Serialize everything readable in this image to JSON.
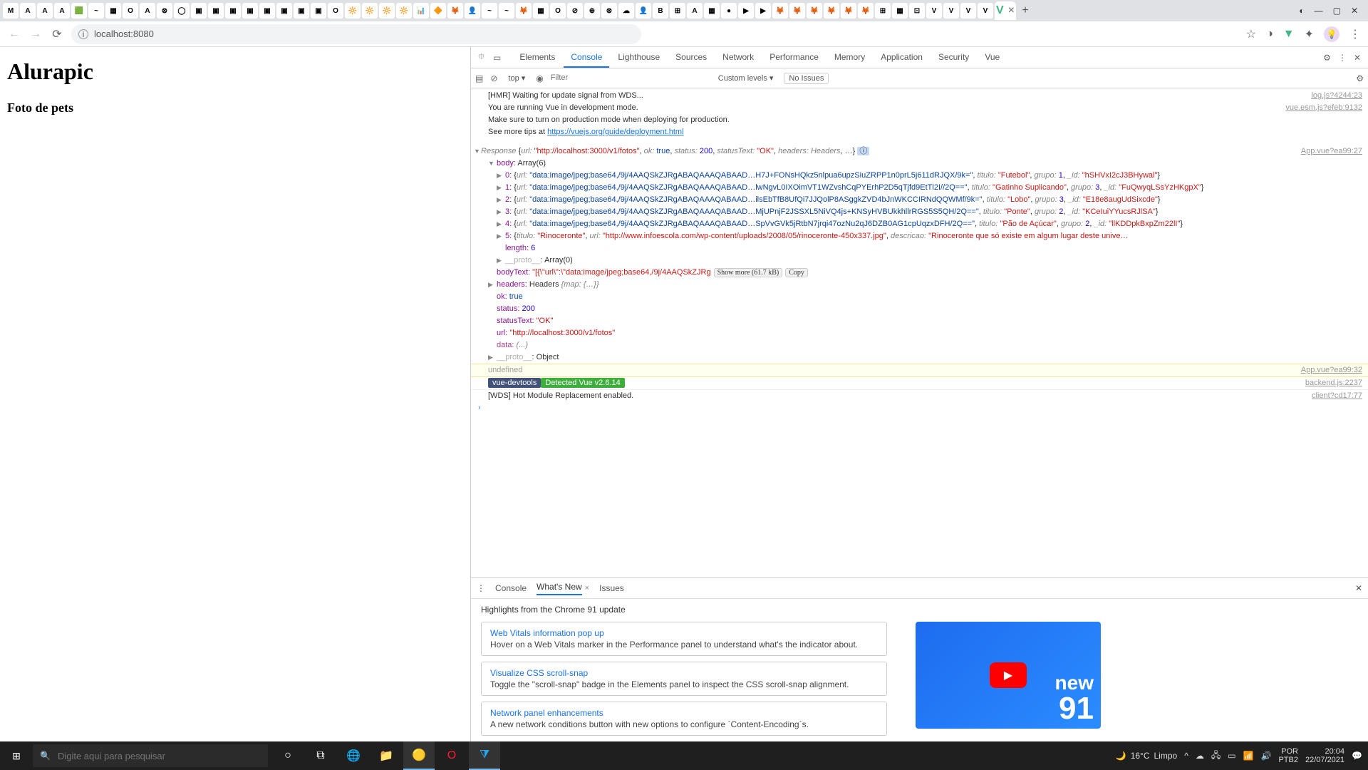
{
  "browser": {
    "url": "localhost:8080",
    "tab_favicons": [
      "M",
      "A",
      "A",
      "A",
      "🟩",
      "~",
      "▦",
      "O",
      "A",
      "⊗",
      "◯",
      "▣",
      "▣",
      "▣",
      "▣",
      "▣",
      "▣",
      "▣",
      "▣",
      "O",
      "🔆",
      "🔆",
      "🔆",
      "🔆",
      "📊",
      "🔶",
      "🦊",
      "👤",
      "~",
      "~",
      "🦊",
      "▦",
      "O",
      "⊘",
      "⊕",
      "⊗",
      "☁",
      "👤",
      "B",
      "⊞",
      "A",
      "▦",
      "●",
      "▶",
      "▶",
      "🦊",
      "🦊",
      "🦊",
      "🦊",
      "🦊",
      "🦊",
      "⊞",
      "▦",
      "⊡",
      "V",
      "V",
      "V",
      "V"
    ],
    "active_tab_icon": "V",
    "new_tab": "+"
  },
  "page": {
    "title": "Alurapic",
    "subtitle": "Foto de pets"
  },
  "devtools": {
    "tabs": [
      "Elements",
      "Console",
      "Lighthouse",
      "Sources",
      "Network",
      "Performance",
      "Memory",
      "Application",
      "Security",
      "Vue"
    ],
    "active_tab": "Console",
    "context": "top ▾",
    "filter_placeholder": "Filter",
    "levels": "Custom levels ▾",
    "no_issues": "No Issues",
    "logs": {
      "hmr": "[HMR] Waiting for update signal from WDS...",
      "hmr_src": "log.js?4244:23",
      "vue_dev1": "You are running Vue in development mode.",
      "vue_dev2": "Make sure to turn on production mode when deploying for production.",
      "vue_dev3": "See more tips at ",
      "vue_link": "https://vuejs.org/guide/deployment.html",
      "vue_src": "vue.esm.js?efeb:9132",
      "app_src1": "App.vue?ea99:27",
      "response_head": "Response",
      "response_url": "\"http://localhost:3000/v1/fotos\"",
      "body_label": "body:",
      "body_val": "Array(6)",
      "items": [
        {
          "idx": "0:",
          "url": "\"data:image/jpeg;base64,/9j/4AAQSkZJRgABAQAAAQABAAD…H7J+FONsHQkz5nlpua6upzSiuZRPP1n0prL5j611dRJQX/9k=\"",
          "titulo": "\"Futebol\"",
          "grupo": "1",
          "_id": "\"hSHVxI2cJ3BHywal\""
        },
        {
          "idx": "1:",
          "url": "\"data:image/jpeg;base64,/9j/4AAQSkZJRgABAQAAAQABAAD…lwNgvL0IXOimVT1WZvshCqPYErhP2D5qTjfd9EtTl2I//2Q==\"",
          "titulo": "\"Gatinho Suplicando\"",
          "grupo": "3",
          "_id": "\"FuQwyqLSsYzHKgpX\""
        },
        {
          "idx": "2:",
          "url": "\"data:image/jpeg;base64,/9j/4AAQSkZJRgABAQAAAQABAAD…ilsEbTfB8UfQi7JJQolP8ASggkZVD4bJnWKCCIRNdQQWMf/9k=\"",
          "titulo": "\"Lobo\"",
          "grupo": "3",
          "_id": "\"E18e8augUdSixcde\""
        },
        {
          "idx": "3:",
          "url": "\"data:image/jpeg;base64,/9j/4AAQSkZJRgABAQAAAQABAAD…MjUPnjF2JSSXL5NiVQ4js+KNSyHVBUkkhllrRGS5S5QH/2Q==\"",
          "titulo": "\"Ponte\"",
          "grupo": "2",
          "_id": "\"KCeIuiYYucsRJlSA\""
        },
        {
          "idx": "4:",
          "url": "\"data:image/jpeg;base64,/9j/4AAQSkZJRgABAQAAAQABAAD…SpVvGVk5jRtbN7jrqi47ozNu2qJ6DZB0AG1cpUqzxDFH/2Q==\"",
          "titulo": "\"Pão de Açúcar\"",
          "grupo": "2",
          "_id": "\"llKDDpkBxpZm22lI\""
        }
      ],
      "item5_titulo": "\"Rinoceronte\"",
      "item5_url": "\"http://www.infoescola.com/wp-content/uploads/2008/05/rinoceronte-450x337.jpg\"",
      "item5_desc_key": "descricao:",
      "item5_desc": "\"Rinoceronte que só existe em algum lugar deste unive…",
      "length": "6",
      "proto_arr": "Array(0)",
      "bodyText_key": "bodyText:",
      "bodyText_val": "\"[{\\\"url\\\":\\\"data:image/jpeg;base64,/9j/4AAQSkZJRg",
      "show_more": "Show more (61.7 kB)",
      "copy": "Copy",
      "headers_key": "headers:",
      "headers_val": "Headers",
      "headers_brace": "{map: {…}}",
      "ok_key": "ok:",
      "ok_val": "true",
      "status_key": "status:",
      "status_val": "200",
      "statusText_key": "statusText:",
      "statusText_val": "\"OK\"",
      "url_key": "url:",
      "url_val": "\"http://localhost:3000/v1/fotos\"",
      "data_key": "data:",
      "data_val": "(...)",
      "proto_obj": "Object",
      "undefined": "undefined",
      "undefined_src": "App.vue?ea99:32",
      "dt_pill": "vue-devtools",
      "dt_detect": "Detected Vue v2.6.14",
      "dt_src": "backend.js:2237",
      "wds": "[WDS] Hot Module Replacement enabled.",
      "wds_src": "client?cd17:77"
    },
    "drawer": {
      "tabs": [
        "Console",
        "What's New",
        "Issues"
      ],
      "active": "What's New",
      "highlights": "Highlights from the Chrome 91 update",
      "cards": [
        {
          "title": "Web Vitals information pop up",
          "desc": "Hover on a Web Vitals marker in the Performance panel to understand what's the indicator about."
        },
        {
          "title": "Visualize CSS scroll-snap",
          "desc": "Toggle the \"scroll-snap\" badge in the Elements panel to inspect the CSS scroll-snap alignment."
        },
        {
          "title": "Network panel enhancements",
          "desc": "A new network conditions button with new options to configure `Content-Encoding`s."
        }
      ],
      "video_text_top": "new",
      "video_text_bot": "91"
    }
  },
  "taskbar": {
    "search_placeholder": "Digite aqui para pesquisar",
    "weather_temp": "16°C",
    "weather_text": "Limpo",
    "lang1": "POR",
    "lang2": "PTB2",
    "time": "20:04",
    "date": "22/07/2021"
  }
}
